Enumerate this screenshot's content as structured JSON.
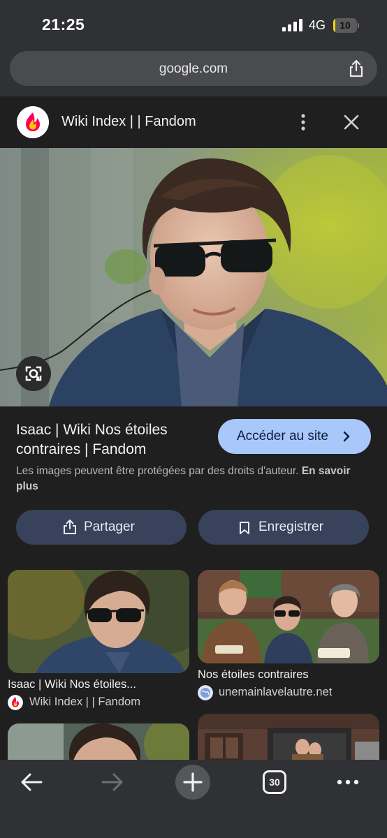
{
  "status_bar": {
    "time": "21:25",
    "network": "4G",
    "battery": "10",
    "battery_level": 0.1
  },
  "browser": {
    "url": "google.com"
  },
  "site_header": {
    "title": "Wiki Index | | Fandom"
  },
  "result": {
    "title": "Isaac | Wiki Nos étoiles contraires | Fandom",
    "visit_label": "Accéder au site",
    "copyright_text": "Les images peuvent être protégées par des droits d'auteur.",
    "learn_more": "En savoir plus",
    "share_label": "Partager",
    "save_label": "Enregistrer"
  },
  "related": [
    {
      "caption": "Isaac | Wiki Nos étoiles...",
      "source": "Wiki Index | | Fandom",
      "source_icon": "fandom-icon"
    },
    {
      "caption": "Nos étoiles contraires",
      "source": "unemainlavelautre.net",
      "source_icon": "globe-icon"
    }
  ],
  "toolbar": {
    "tab_count": "30"
  },
  "colors": {
    "accent": "#a8c7fa",
    "chip": "#38425a",
    "background": "#1f1f1f",
    "bar": "#303134"
  }
}
